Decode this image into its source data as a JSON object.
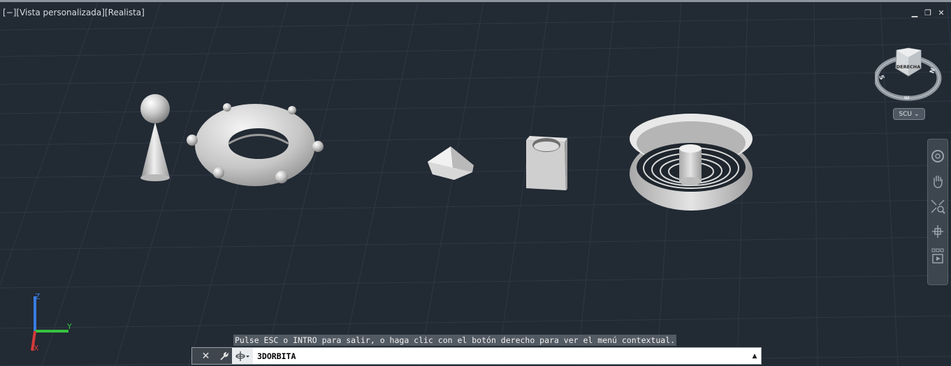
{
  "viewport": {
    "label": "[−][Vista personalizada][Realista]"
  },
  "window_controls": {
    "minimize": "▁",
    "restore": "❐",
    "close": "✕"
  },
  "viewcube": {
    "face": "DERECHA",
    "compass_labels": {
      "west": "S",
      "east": "N",
      "south": "E"
    },
    "ucs_menu": "SCU"
  },
  "ucs_axes": {
    "x": "X",
    "y": "Y",
    "z": "Z"
  },
  "status_message": "Pulse ESC o INTRO para salir, o haga clic con el botón derecho para ver el menú contextual.",
  "command_line": {
    "value": "3DORBITA",
    "close_icon": "close-icon",
    "customize_icon": "wrench-icon",
    "recent_icon": "orbit-icon"
  },
  "navbar": {
    "tools": [
      "steering-wheel-icon",
      "pan-icon",
      "zoom-icon",
      "orbit-icon",
      "showmotion-icon"
    ]
  },
  "colors": {
    "background": "#222a34",
    "grid": "#2f3843",
    "solid": "#c8c8c8",
    "axis_x": "#d33a3a",
    "axis_y": "#36c23e",
    "axis_z": "#3a7ce0"
  }
}
